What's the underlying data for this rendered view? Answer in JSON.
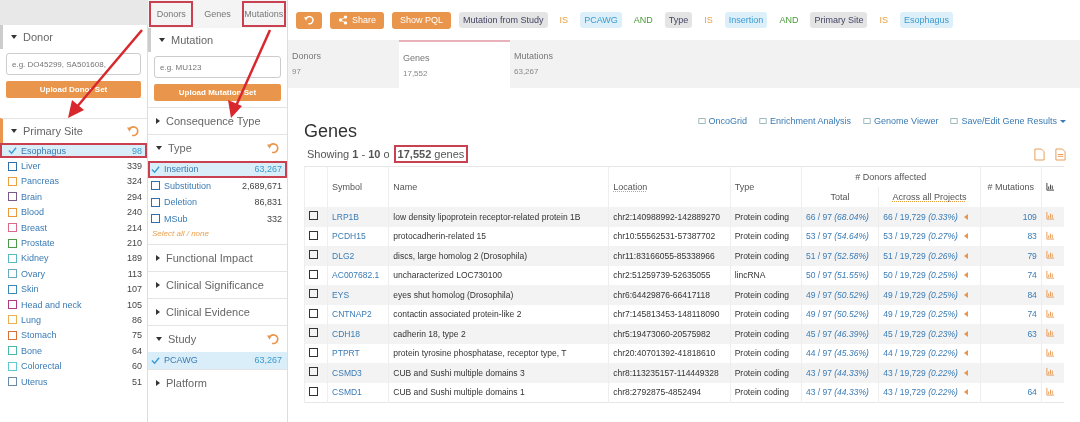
{
  "donor_panel": {
    "title": "Donor",
    "expanded": true,
    "placeholder": "e.g. DO45299, SA501608,",
    "upload_button": "Upload Donor Set"
  },
  "primary_site": {
    "title": "Primary Site",
    "expanded": true,
    "terms": [
      {
        "label": "Esophagus",
        "count": "98",
        "selected": true,
        "annotated": true
      },
      {
        "label": "Liver",
        "count": "339",
        "selected": false,
        "annotated": false,
        "color": "#2f6fa8"
      },
      {
        "label": "Pancreas",
        "count": "324",
        "selected": false,
        "annotated": false,
        "color": "#e8a040"
      },
      {
        "label": "Brain",
        "count": "294",
        "selected": false,
        "annotated": false,
        "color": "#7a5a8a"
      },
      {
        "label": "Blood",
        "count": "240",
        "selected": false,
        "annotated": false,
        "color": "#e89a3a"
      },
      {
        "label": "Breast",
        "count": "214",
        "selected": false,
        "annotated": false,
        "color": "#d96a8a"
      },
      {
        "label": "Prostate",
        "count": "210",
        "selected": false,
        "annotated": false,
        "color": "#4a9a4a"
      },
      {
        "label": "Kidney",
        "count": "189",
        "selected": false,
        "annotated": false,
        "color": "#5ab8c0"
      },
      {
        "label": "Ovary",
        "count": "113",
        "selected": false,
        "annotated": false,
        "color": "#6aa8c0"
      },
      {
        "label": "Skin",
        "count": "107",
        "selected": false,
        "annotated": false,
        "color": "#3a8ab5"
      },
      {
        "label": "Head and neck",
        "count": "105",
        "selected": false,
        "annotated": false,
        "color": "#b03a8a"
      },
      {
        "label": "Lung",
        "count": "86",
        "selected": false,
        "annotated": false,
        "color": "#e8b050"
      },
      {
        "label": "Stomach",
        "count": "75",
        "selected": false,
        "annotated": false,
        "color": "#d9703a"
      },
      {
        "label": "Bone",
        "count": "64",
        "selected": false,
        "annotated": false,
        "color": "#4ab8a8"
      },
      {
        "label": "Colorectal",
        "count": "60",
        "selected": false,
        "annotated": false,
        "color": "#60c8d0"
      },
      {
        "label": "Uterus",
        "count": "51",
        "selected": false,
        "annotated": false,
        "color": "#6a8aa8"
      }
    ]
  },
  "facet_tabs": [
    {
      "label": "Donors",
      "annotated": true
    },
    {
      "label": "Genes",
      "annotated": false
    },
    {
      "label": "Mutations",
      "annotated": true
    }
  ],
  "facets": [
    {
      "kind": "search",
      "title": "Mutation",
      "placeholder": "e.g. MU123",
      "upload_button": "Upload Mutation Set"
    },
    {
      "kind": "collapsed",
      "title": "Consequence Type"
    },
    {
      "kind": "terms",
      "title": "Type",
      "select_all": "Select all / none",
      "terms": [
        {
          "label": "Insertion",
          "count": "63,267",
          "selected": true,
          "annotated": true
        },
        {
          "label": "Substitution",
          "count": "2,689,671",
          "selected": false,
          "annotated": false
        },
        {
          "label": "Deletion",
          "count": "86,831",
          "selected": false,
          "annotated": false
        },
        {
          "label": "MSub",
          "count": "332",
          "selected": false,
          "annotated": false
        }
      ]
    },
    {
      "kind": "collapsed",
      "title": "Functional Impact"
    },
    {
      "kind": "collapsed",
      "title": "Clinical Significance"
    },
    {
      "kind": "collapsed",
      "title": "Clinical Evidence"
    },
    {
      "kind": "terms",
      "title": "Study",
      "terms": [
        {
          "label": "PCAWG",
          "count": "63,267",
          "selected": true,
          "annotated": false
        }
      ]
    },
    {
      "kind": "collapsed",
      "title": "Platform"
    }
  ],
  "toolbar": {
    "share_button": "Share",
    "pql_button": "Show PQL"
  },
  "query": [
    {
      "kind": "field",
      "text": "Mutation from Study"
    },
    {
      "kind": "op",
      "text": "IS"
    },
    {
      "kind": "value",
      "text": "PCAWG"
    },
    {
      "kind": "conj",
      "text": "AND"
    },
    {
      "kind": "field",
      "text": "Type"
    },
    {
      "kind": "op",
      "text": "IS"
    },
    {
      "kind": "value",
      "text": "Insertion"
    },
    {
      "kind": "conj",
      "text": "AND"
    },
    {
      "kind": "field",
      "text": "Primary Site"
    },
    {
      "kind": "op",
      "text": "IS"
    },
    {
      "kind": "value",
      "text": "Esophagus"
    }
  ],
  "result_tabs": [
    {
      "label": "Donors",
      "count": "97",
      "selected": false
    },
    {
      "label": "Genes",
      "count": "17,552",
      "selected": true
    },
    {
      "label": "Mutations",
      "count": "63,267",
      "selected": false
    }
  ],
  "genes": {
    "title": "Genes",
    "actions": [
      "OncoGrid",
      "Enrichment Analysis",
      "Genome Viewer",
      "Save/Edit Gene Results"
    ],
    "showing": {
      "prefix": "Showing",
      "from": "1",
      "dash": "-",
      "to": "10",
      "of": "o",
      "total": "17,552",
      "unit": "genes"
    },
    "columns": {
      "symbol": "Symbol",
      "name": "Name",
      "location": "Location",
      "type": "Type",
      "donors_group": "# Donors affected",
      "total": "Total",
      "across": "Across all Projects",
      "mutations": "# Mutations"
    },
    "rows": [
      {
        "checked": false,
        "symbol": "LRP1B",
        "name": "low density lipoprotein receptor-related protein 1B",
        "location": "chr2:140988992-142889270",
        "type": "Protein coding",
        "total": "66 / 97 *(68.04%)*",
        "across": "66 / 19,729 *(0.33%)*",
        "mutations": "109"
      },
      {
        "checked": false,
        "symbol": "PCDH15",
        "name": "protocadherin-related 15",
        "location": "chr10:55562531-57387702",
        "type": "Protein coding",
        "total": "53 / 97 *(54.64%)*",
        "across": "53 / 19,729 *(0.27%)*",
        "mutations": "83"
      },
      {
        "checked": false,
        "symbol": "DLG2",
        "name": "discs, large homolog 2 (Drosophila)",
        "location": "chr11:83166055-85338966",
        "type": "Protein coding",
        "total": "51 / 97 *(52.58%)*",
        "across": "51 / 19,729 *(0.26%)*",
        "mutations": "79"
      },
      {
        "checked": false,
        "symbol": "AC007682.1",
        "name": "uncharacterized LOC730100",
        "location": "chr2:51259739-52635055",
        "type": "lincRNA",
        "total": "50 / 97 *(51.55%)*",
        "across": "50 / 19,729 *(0.25%)*",
        "mutations": "74"
      },
      {
        "checked": false,
        "symbol": "EYS",
        "name": "eyes shut homolog (Drosophila)",
        "location": "chr6:64429876-66417118",
        "type": "Protein coding",
        "total": "49 / 97 *(50.52%)*",
        "across": "49 / 19,729 *(0.25%)*",
        "mutations": "84"
      },
      {
        "checked": false,
        "symbol": "CNTNAP2",
        "name": "contactin associated protein-like 2",
        "location": "chr7:145813453-148118090",
        "type": "Protein coding",
        "total": "49 / 97 *(50.52%)*",
        "across": "49 / 19,729 *(0.25%)*",
        "mutations": "74"
      },
      {
        "checked": false,
        "symbol": "CDH18",
        "name": "cadherin 18, type 2",
        "location": "chr5:19473060-20575982",
        "type": "Protein coding",
        "total": "45 / 97 *(46.39%)*",
        "across": "45 / 19,729 *(0.23%)*",
        "mutations": "63"
      },
      {
        "checked": false,
        "symbol": "PTPRT",
        "name": "protein tyrosine phosphatase, receptor type, T",
        "location": "chr20:40701392-41818610",
        "type": "Protein coding",
        "total": "44 / 97 *(45.36%)*",
        "across": "44 / 19,729 *(0.22%)*"
      },
      {
        "checked": false,
        "symbol": "CSMD3",
        "name": "CUB and Sushi multiple domains 3",
        "location": "chr8:113235157-114449328",
        "type": "Protein coding",
        "total": "43 / 97 *(44.33%)*",
        "across": "43 / 19,729 *(0.22%)*"
      },
      {
        "checked": false,
        "symbol": "CSMD1",
        "name": "CUB and Sushi multiple domains 1",
        "location": "chr8:2792875-4852494",
        "type": "Protein coding",
        "total": "43 / 97 *(44.33%)*",
        "across": "43 / 19,729 *(0.22%)*",
        "mutations": "64"
      }
    ]
  }
}
